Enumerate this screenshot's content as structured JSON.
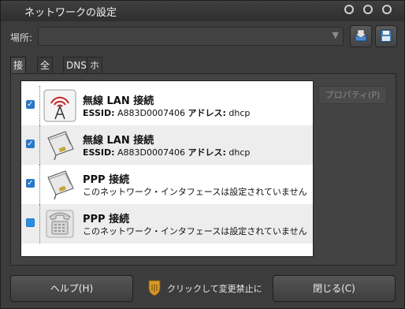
{
  "window": {
    "title": "ネットワークの設定"
  },
  "location": {
    "label": "場所:",
    "value": ""
  },
  "tabs": [
    "接続",
    "全般",
    "DNS",
    "ホスト"
  ],
  "connections": [
    {
      "name": "無線 LAN 接続",
      "detail_label": "ESSID:",
      "detail_value": "A883D0007406",
      "addr_label": "アドレス:",
      "addr_value": "dhcp",
      "checked": true,
      "icon": "wireless-tower-icon"
    },
    {
      "name": "無線 LAN 接続",
      "detail_label": "ESSID:",
      "detail_value": "A883D0007406",
      "addr_label": "アドレス:",
      "addr_value": "dhcp",
      "checked": true,
      "icon": "network-card-icon"
    },
    {
      "name": "PPP 接続",
      "description": "このネットワーク・インタフェースは設定されていません",
      "checked": true,
      "icon": "network-card-icon"
    },
    {
      "name": "PPP 接続",
      "description": "このネットワーク・インタフェースは設定されていません",
      "checked": false,
      "icon": "telephone-icon"
    }
  ],
  "buttons": {
    "properties": "プロパティ(P)",
    "help": "ヘルプ(H)",
    "lock_text": "クリックして変更禁止に",
    "close": "閉じる(C)"
  },
  "colors": {
    "accent": "#2a78c6",
    "background": "#3c3c3c"
  }
}
